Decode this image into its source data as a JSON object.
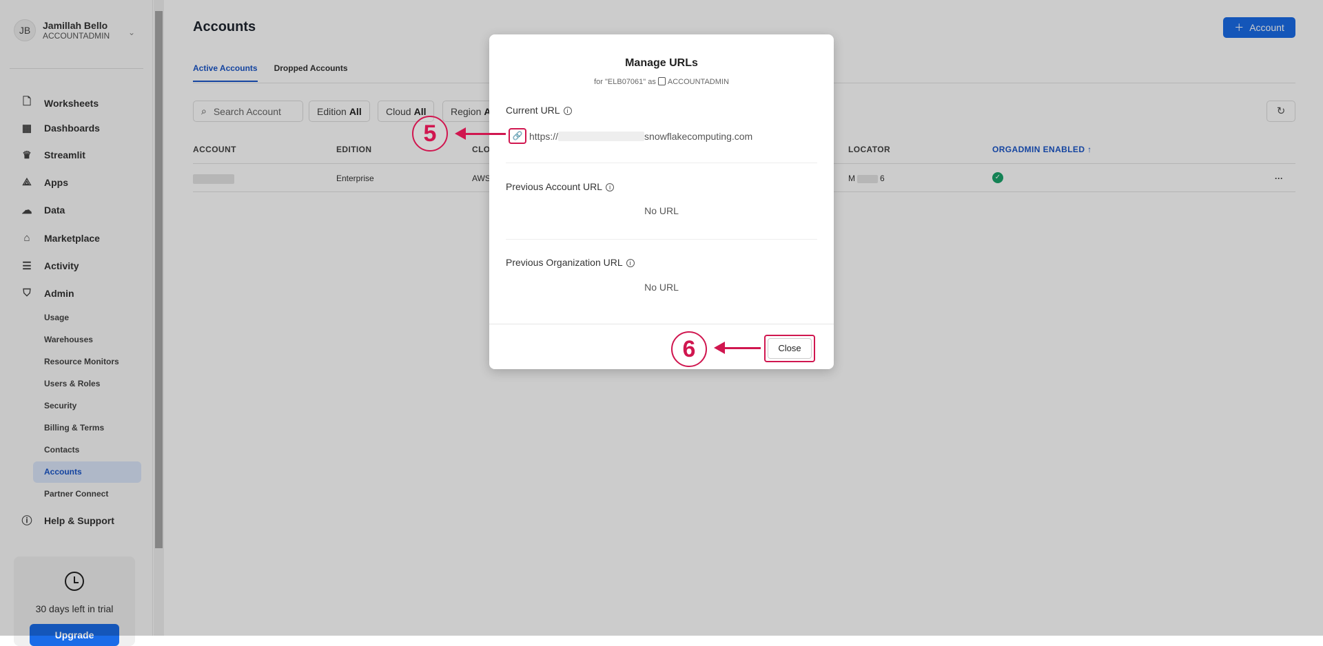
{
  "user": {
    "initials": "JB",
    "name": "Jamillah Bello",
    "role": "ACCOUNTADMIN"
  },
  "nav": [
    {
      "label": "Worksheets",
      "icon": "document-icon"
    },
    {
      "label": "Dashboards",
      "icon": "grid-icon"
    },
    {
      "label": "Streamlit",
      "icon": "crown-icon"
    },
    {
      "label": "Apps",
      "icon": "apps-icon"
    },
    {
      "label": "Data",
      "icon": "cloud-icon"
    },
    {
      "label": "Marketplace",
      "icon": "store-icon"
    },
    {
      "label": "Activity",
      "icon": "activity-icon"
    },
    {
      "label": "Admin",
      "icon": "shield-icon"
    }
  ],
  "admin_sub": [
    "Usage",
    "Warehouses",
    "Resource Monitors",
    "Users & Roles",
    "Security",
    "Billing & Terms",
    "Contacts",
    "Accounts",
    "Partner Connect"
  ],
  "help": "Help & Support",
  "trial": {
    "text": "30 days left in trial",
    "button": "Upgrade"
  },
  "page": {
    "title": "Accounts",
    "add_button": "Account",
    "tabs": [
      "Active Accounts",
      "Dropped Accounts"
    ],
    "search_placeholder": "Search Account",
    "filters": [
      {
        "label": "Edition",
        "value": "All"
      },
      {
        "label": "Cloud",
        "value": "All"
      },
      {
        "label": "Region",
        "value": "All"
      }
    ],
    "columns": [
      "ACCOUNT",
      "EDITION",
      "CLOUD",
      "LOCATOR",
      "ORGADMIN ENABLED"
    ],
    "rows": [
      {
        "edition": "Enterprise",
        "cloud": "AWS",
        "locator_start": "M",
        "locator_end": "6",
        "orgadmin": true
      }
    ]
  },
  "modal": {
    "title": "Manage URLs",
    "subtitle_prefix": "for \"ELB07061\" as",
    "subtitle_role": "ACCOUNTADMIN",
    "current_label": "Current URL",
    "current_url_prefix": "https://",
    "current_url_suffix": "snowflakecomputing.com",
    "prev_account_label": "Previous Account URL",
    "prev_account_value": "No URL",
    "prev_org_label": "Previous Organization URL",
    "prev_org_value": "No URL",
    "close": "Close"
  },
  "annotations": {
    "step5": "5",
    "step6": "6",
    "color": "#d0164f"
  },
  "colors": {
    "accent": "#1a6ce8",
    "success": "#1aa36b"
  }
}
